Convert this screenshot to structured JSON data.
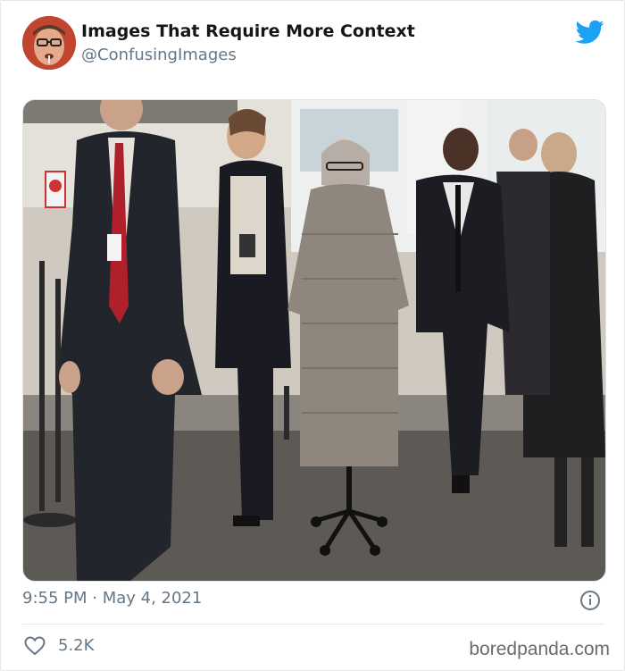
{
  "tweet": {
    "display_name": "Images That Require More Context",
    "handle": "@ConfusingImages",
    "timestamp": "9:55 PM · May 4, 2021",
    "likes": "5.2K"
  },
  "icons": {
    "brand": "twitter-bird-icon",
    "info": "info-icon",
    "like": "heart-icon"
  },
  "colors": {
    "twitter_blue": "#1da1f2",
    "text_primary": "#14171a",
    "text_secondary": "#657786"
  },
  "watermark": "boredpanda.com"
}
